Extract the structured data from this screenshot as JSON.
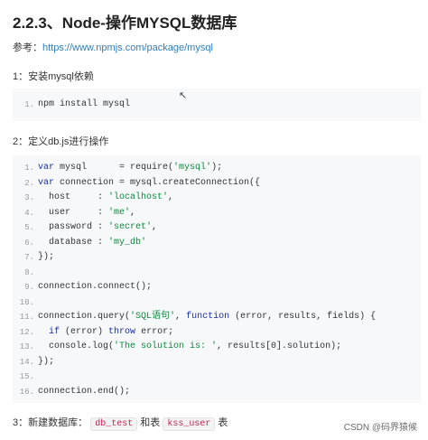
{
  "header": {
    "title": "2.2.3、Node-操作MYSQL数据库"
  },
  "reference": {
    "label": "参考：",
    "url": "https://www.npmjs.com/package/mysql"
  },
  "steps": [
    {
      "label": "1：安装mysql依赖"
    },
    {
      "label": "2：定义db.js进行操作"
    }
  ],
  "step3": {
    "prefix": "3：新建数据库：",
    "db": "db_test",
    "mid": "和表",
    "table": "kss_user",
    "suffix": "表"
  },
  "code1": [
    {
      "n": "1.",
      "parts": [
        [
          "npm install mysql",
          ""
        ]
      ]
    }
  ],
  "code2": [
    {
      "n": "1.",
      "parts": [
        [
          "var",
          "kw"
        ],
        [
          " mysql      = require(",
          ""
        ],
        [
          "'mysql'",
          "str"
        ],
        [
          ");",
          ""
        ]
      ]
    },
    {
      "n": "2.",
      "parts": [
        [
          "var",
          "kw"
        ],
        [
          " connection = mysql.createConnection({",
          ""
        ]
      ]
    },
    {
      "n": "3.",
      "parts": [
        [
          "  host     : ",
          ""
        ],
        [
          "'localhost'",
          "str"
        ],
        [
          ",",
          ""
        ]
      ]
    },
    {
      "n": "4.",
      "parts": [
        [
          "  user     : ",
          ""
        ],
        [
          "'me'",
          "str"
        ],
        [
          ",",
          ""
        ]
      ]
    },
    {
      "n": "5.",
      "parts": [
        [
          "  password : ",
          ""
        ],
        [
          "'secret'",
          "str"
        ],
        [
          ",",
          ""
        ]
      ]
    },
    {
      "n": "6.",
      "parts": [
        [
          "  database : ",
          ""
        ],
        [
          "'my_db'",
          "str"
        ]
      ]
    },
    {
      "n": "7.",
      "parts": [
        [
          "});",
          ""
        ]
      ]
    },
    {
      "n": "8.",
      "parts": []
    },
    {
      "n": "9.",
      "parts": [
        [
          "connection.connect();",
          ""
        ]
      ]
    },
    {
      "n": "10.",
      "parts": []
    },
    {
      "n": "11.",
      "parts": [
        [
          "connection.query(",
          ""
        ],
        [
          "'SQL语句'",
          "str"
        ],
        [
          ", ",
          ""
        ],
        [
          "function",
          "kw"
        ],
        [
          " (error, results, fields) {",
          ""
        ]
      ]
    },
    {
      "n": "12.",
      "parts": [
        [
          "  ",
          ""
        ],
        [
          "if",
          "kw"
        ],
        [
          " (error) ",
          ""
        ],
        [
          "throw",
          "kw"
        ],
        [
          " error;",
          ""
        ]
      ]
    },
    {
      "n": "13.",
      "parts": [
        [
          "  console.log(",
          ""
        ],
        [
          "'The solution is: '",
          "str"
        ],
        [
          ", results[0].solution);",
          ""
        ]
      ]
    },
    {
      "n": "14.",
      "parts": [
        [
          "});",
          ""
        ]
      ]
    },
    {
      "n": "15.",
      "parts": []
    },
    {
      "n": "16.",
      "parts": [
        [
          "connection.end();",
          ""
        ]
      ]
    }
  ],
  "cursor_glyph": "↖",
  "watermark": "CSDN @码界猿候"
}
